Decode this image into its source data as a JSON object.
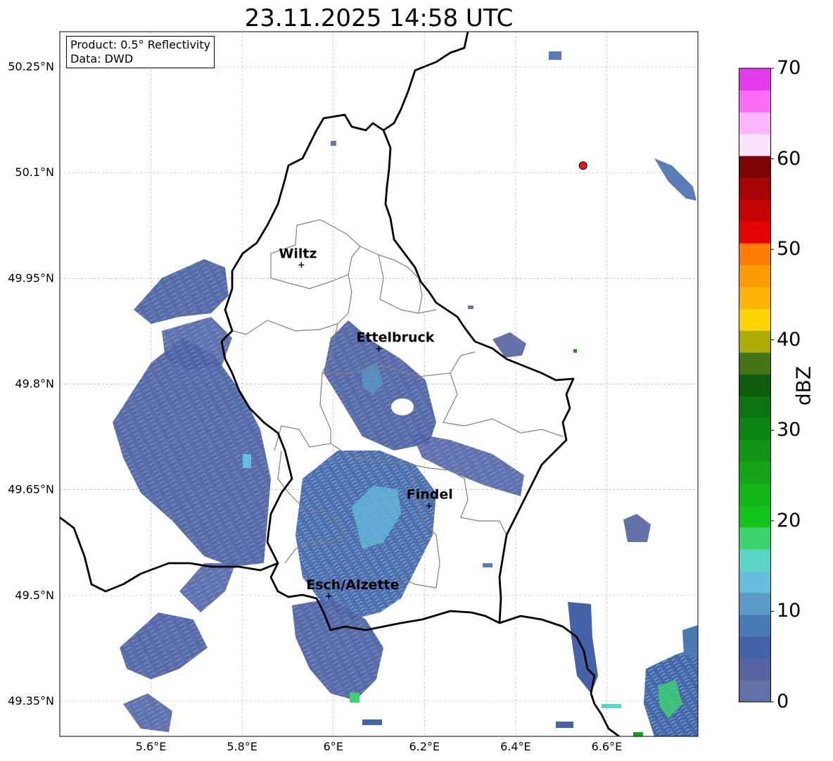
{
  "title": "23.11.2025 14:58 UTC",
  "info": {
    "product": "Product: 0.5° Reflectivity",
    "source": "Data: DWD"
  },
  "map": {
    "lon_range": [
      5.4,
      6.8
    ],
    "lat_range": [
      49.3,
      50.3
    ],
    "lat_ticks": [
      {
        "value": 49.35,
        "label": "49.35°N"
      },
      {
        "value": 49.5,
        "label": "49.5°N"
      },
      {
        "value": 49.65,
        "label": "49.65°N"
      },
      {
        "value": 49.8,
        "label": "49.8°N"
      },
      {
        "value": 49.95,
        "label": "49.95°N"
      },
      {
        "value": 50.1,
        "label": "50.1°N"
      },
      {
        "value": 50.25,
        "label": "50.25°N"
      }
    ],
    "lon_ticks": [
      {
        "value": 5.6,
        "label": "5.6°E"
      },
      {
        "value": 5.8,
        "label": "5.8°E"
      },
      {
        "value": 6.0,
        "label": "6°E"
      },
      {
        "value": 6.2,
        "label": "6.2°E"
      },
      {
        "value": 6.4,
        "label": "6.4°E"
      },
      {
        "value": 6.6,
        "label": "6.6°E"
      }
    ],
    "cities": [
      {
        "name": "Wiltz",
        "lon": 5.93,
        "lat": 49.969
      },
      {
        "name": "Ettelbruck",
        "lon": 6.1,
        "lat": 49.85
      },
      {
        "name": "Findel",
        "lon": 6.21,
        "lat": 49.627
      },
      {
        "name": "Esch/Alzette",
        "lon": 5.99,
        "lat": 49.499
      }
    ],
    "radar_site": {
      "lon": 6.548,
      "lat": 50.11,
      "color": "#e8101a"
    },
    "border_color": "#000000",
    "canton_color": "#808080"
  },
  "colorbar": {
    "label": "dBZ",
    "min": 0,
    "max": 70,
    "tick_labels": [
      {
        "value": 0,
        "label": "0"
      },
      {
        "value": 10,
        "label": "10"
      },
      {
        "value": 20,
        "label": "20"
      },
      {
        "value": 30,
        "label": "30"
      },
      {
        "value": 40,
        "label": "40"
      },
      {
        "value": 50,
        "label": "50"
      },
      {
        "value": 60,
        "label": "60"
      },
      {
        "value": 70,
        "label": "70"
      }
    ],
    "colors": [
      "#6272a8",
      "#5565a2",
      "#4462a8",
      "#4a7ab4",
      "#5a9bc8",
      "#64bedc",
      "#5cd4c4",
      "#3cd46c",
      "#14c41c",
      "#14b41c",
      "#14a414",
      "#149414",
      "#0c8414",
      "#0c7414",
      "#0c5c0c",
      "#447414",
      "#acac04",
      "#fcd404",
      "#fcb404",
      "#fc9c04",
      "#fc7c04",
      "#e40404",
      "#c40404",
      "#a40404",
      "#7c0404",
      "#fce4fc",
      "#fcb4fc",
      "#fc6cf4",
      "#e43cec"
    ]
  },
  "echo_colors": {
    "main": "#5266a8",
    "mid": "#4462a8",
    "light": "#5a9bc8",
    "cyan": "#64bedc",
    "green": "#3cd46c"
  }
}
